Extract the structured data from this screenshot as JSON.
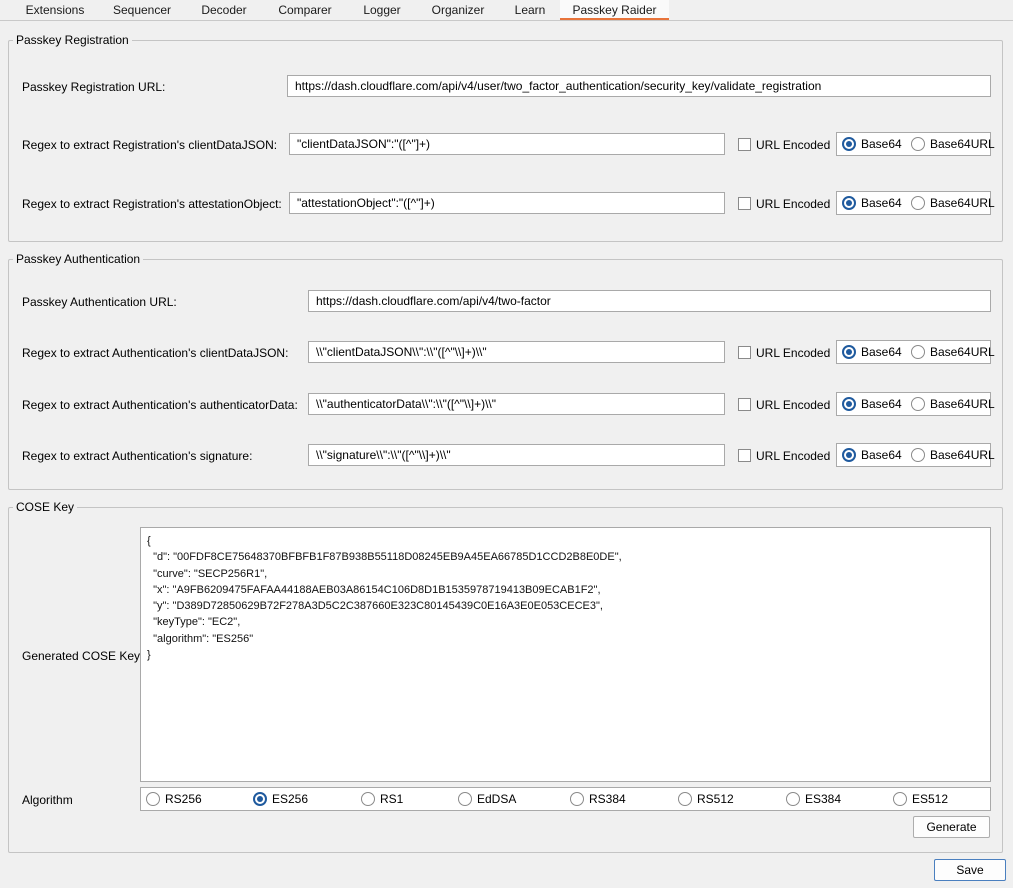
{
  "tabs": [
    {
      "label": "Extensions"
    },
    {
      "label": "Sequencer"
    },
    {
      "label": "Decoder"
    },
    {
      "label": "Comparer"
    },
    {
      "label": "Logger"
    },
    {
      "label": "Organizer"
    },
    {
      "label": "Learn"
    },
    {
      "label": "Passkey Raider",
      "active": true
    }
  ],
  "registration": {
    "title": "Passkey Registration",
    "url_label": "Passkey Registration URL:",
    "url_value": "https://dash.cloudflare.com/api/v4/user/two_factor_authentication/security_key/validate_registration",
    "rows": [
      {
        "label": "Regex to extract Registration's clientDataJSON:",
        "value": "\"clientDataJSON\":\"([^\"]+)",
        "url_encoded": false,
        "encoding": "Base64"
      },
      {
        "label": "Regex to extract Registration's attestationObject:",
        "value": "\"attestationObject\":\"([^\"]+)",
        "url_encoded": false,
        "encoding": "Base64"
      }
    ]
  },
  "authentication": {
    "title": "Passkey Authentication",
    "url_label": "Passkey Authentication URL:",
    "url_value": "https://dash.cloudflare.com/api/v4/two-factor",
    "rows": [
      {
        "label": "Regex to extract Authentication's clientDataJSON:",
        "value": "\\\\\"clientDataJSON\\\\\":\\\\\"([^\"\\\\]+)\\\\\"",
        "url_encoded": false,
        "encoding": "Base64"
      },
      {
        "label": "Regex to extract Authentication's authenticatorData:",
        "value": "\\\\\"authenticatorData\\\\\":\\\\\"([^\"\\\\]+)\\\\\"",
        "url_encoded": false,
        "encoding": "Base64"
      },
      {
        "label": "Regex to extract Authentication's signature:",
        "value": "\\\\\"signature\\\\\":\\\\\"([^\"\\\\]+)\\\\\"",
        "url_encoded": false,
        "encoding": "Base64"
      }
    ]
  },
  "common": {
    "url_encoded_label": "URL Encoded",
    "base64_label": "Base64",
    "base64url_label": "Base64URL"
  },
  "cose": {
    "title": "COSE Key",
    "generated_label": "Generated COSE Key",
    "generated_value": "{\n  \"d\": \"00FDF8CE75648370BFBFB1F87B938B55118D08245EB9A45EA66785D1CCD2B8E0DE\",\n  \"curve\": \"SECP256R1\",\n  \"x\": \"A9FB6209475FAFAA44188AEB03A86154C106D8D1B1535978719413B09ECAB1F2\",\n  \"y\": \"D389D72850629B72F278A3D5C2C387660E323C80145439C0E16A3E0E053CECE3\",\n  \"keyType\": \"EC2\",\n  \"algorithm\": \"ES256\"\n}",
    "algorithm_label": "Algorithm",
    "algorithms": [
      "RS256",
      "ES256",
      "RS1",
      "EdDSA",
      "RS384",
      "RS512",
      "ES384",
      "ES512"
    ],
    "selected_algorithm": "ES256",
    "generate_label": "Generate"
  },
  "save_label": "Save",
  "colors": {
    "accent": "#e8743b",
    "radio_selected": "#1f5a9e",
    "background": "#f0f0f0"
  }
}
